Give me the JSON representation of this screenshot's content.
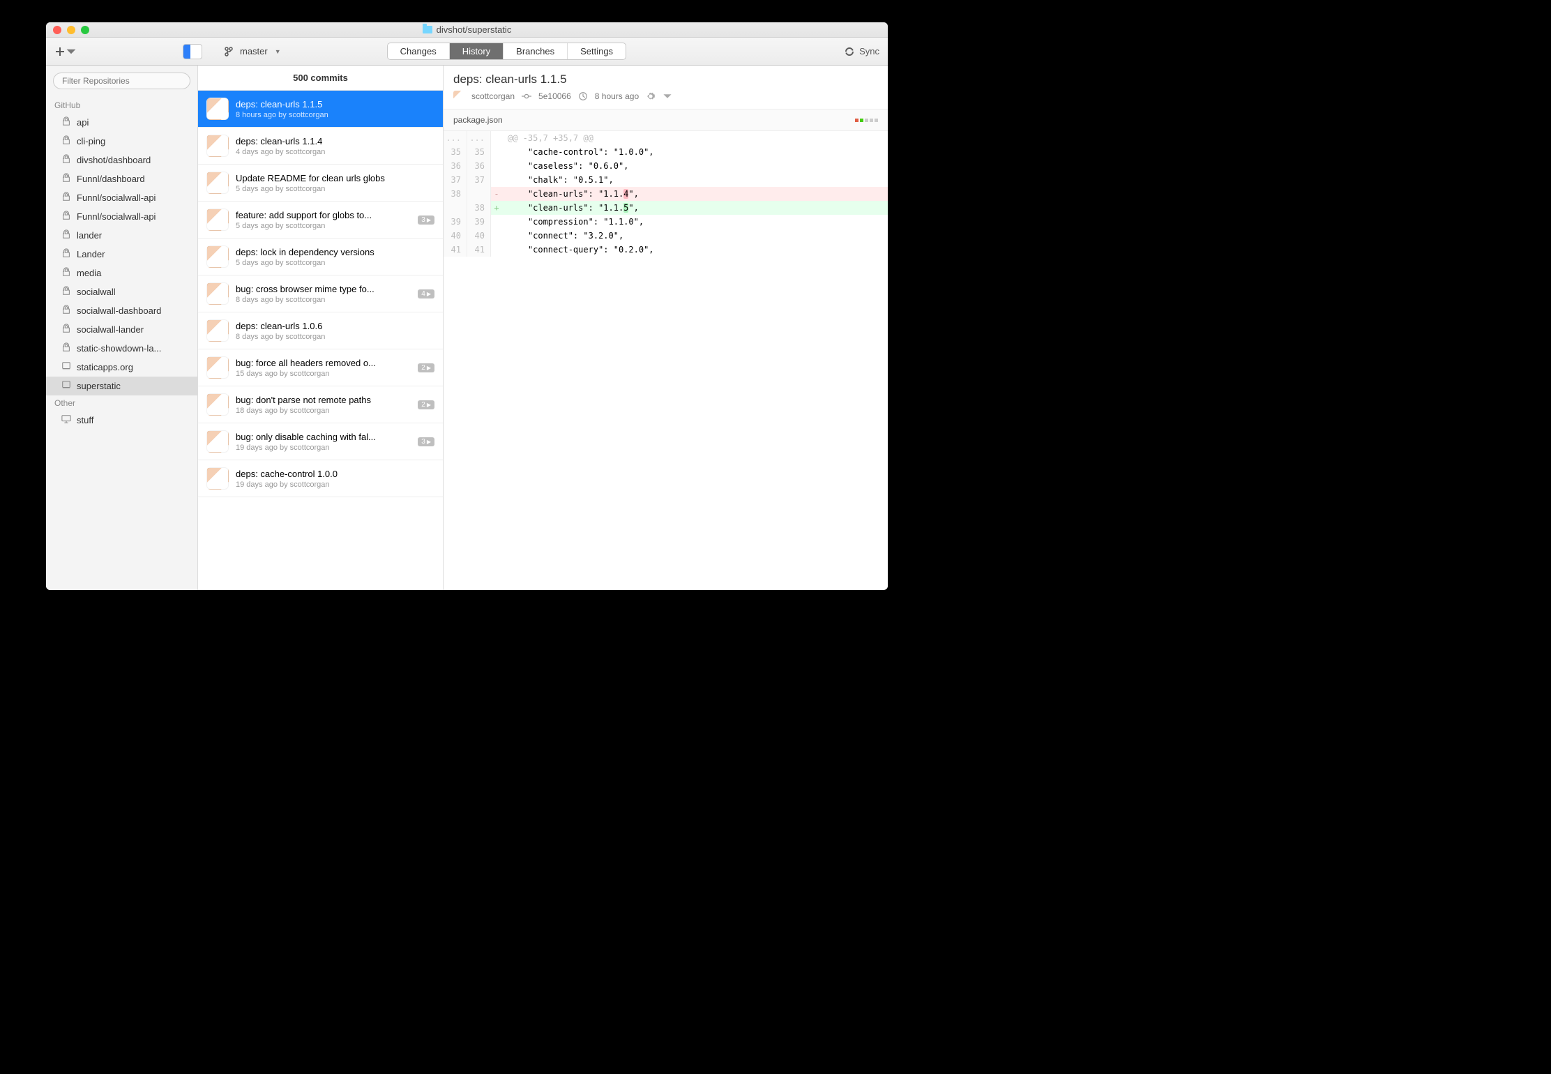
{
  "titlebar": {
    "title": "divshot/superstatic"
  },
  "toolbar": {
    "branch": "master",
    "sync_label": "Sync",
    "tabs": {
      "changes": "Changes",
      "history": "History",
      "branches": "Branches",
      "settings": "Settings",
      "active": "history"
    }
  },
  "sidebar": {
    "filter_placeholder": "Filter Repositories",
    "sections": [
      {
        "label": "GitHub",
        "items": [
          {
            "name": "api",
            "icon": "lock"
          },
          {
            "name": "cli-ping",
            "icon": "lock"
          },
          {
            "name": "divshot/dashboard",
            "icon": "lock"
          },
          {
            "name": "Funnl/dashboard",
            "icon": "lock"
          },
          {
            "name": "Funnl/socialwall-api",
            "icon": "lock"
          },
          {
            "name": "Funnl/socialwall-api",
            "icon": "lock"
          },
          {
            "name": "lander",
            "icon": "lock"
          },
          {
            "name": "Lander",
            "icon": "lock"
          },
          {
            "name": "media",
            "icon": "lock"
          },
          {
            "name": "socialwall",
            "icon": "lock"
          },
          {
            "name": "socialwall-dashboard",
            "icon": "lock"
          },
          {
            "name": "socialwall-lander",
            "icon": "lock"
          },
          {
            "name": "static-showdown-la...",
            "icon": "lock"
          },
          {
            "name": "staticapps.org",
            "icon": "repo"
          },
          {
            "name": "superstatic",
            "icon": "repo",
            "selected": true
          }
        ]
      },
      {
        "label": "Other",
        "items": [
          {
            "name": "stuff",
            "icon": "desktop"
          }
        ]
      }
    ]
  },
  "commits": {
    "header": "500 commits",
    "list": [
      {
        "title": "deps: clean-urls 1.1.5",
        "meta": "8 hours ago by scottcorgan",
        "selected": true
      },
      {
        "title": "deps: clean-urls 1.1.4",
        "meta": "4 days ago by scottcorgan"
      },
      {
        "title": "Update README for clean urls globs",
        "meta": "5 days ago by scottcorgan"
      },
      {
        "title": "feature: add support for globs to...",
        "meta": "5 days ago by scottcorgan",
        "badge": "3"
      },
      {
        "title": "deps: lock in dependency versions",
        "meta": "5 days ago by scottcorgan"
      },
      {
        "title": "bug: cross browser mime type fo...",
        "meta": "8 days ago by scottcorgan",
        "badge": "4"
      },
      {
        "title": "deps: clean-urls 1.0.6",
        "meta": "8 days ago by scottcorgan"
      },
      {
        "title": "bug: force all headers removed o...",
        "meta": "15 days ago by scottcorgan",
        "badge": "2"
      },
      {
        "title": "bug: don't parse not remote paths",
        "meta": "18 days ago by scottcorgan",
        "badge": "2"
      },
      {
        "title": "bug: only disable caching with fal...",
        "meta": "19 days ago by scottcorgan",
        "badge": "3"
      },
      {
        "title": "deps: cache-control 1.0.0",
        "meta": "19 days ago by scottcorgan"
      }
    ]
  },
  "detail": {
    "title": "deps: clean-urls 1.1.5",
    "author": "scottcorgan",
    "sha": "5e10066",
    "time": "8 hours ago",
    "file": "package.json",
    "hunk": "@@ -35,7 +35,7 @@",
    "diff": [
      {
        "old": "35",
        "new": "35",
        "type": "ctx",
        "text": "    \"cache-control\": \"1.0.0\","
      },
      {
        "old": "36",
        "new": "36",
        "type": "ctx",
        "text": "    \"caseless\": \"0.6.0\","
      },
      {
        "old": "37",
        "new": "37",
        "type": "ctx",
        "text": "    \"chalk\": \"0.5.1\","
      },
      {
        "old": "38",
        "new": "",
        "type": "del",
        "pre": "    \"clean-urls\": \"1.1.",
        "hl": "4",
        "post": "\","
      },
      {
        "old": "",
        "new": "38",
        "type": "add",
        "pre": "    \"clean-urls\": \"1.1.",
        "hl": "5",
        "post": "\","
      },
      {
        "old": "39",
        "new": "39",
        "type": "ctx",
        "text": "    \"compression\": \"1.1.0\","
      },
      {
        "old": "40",
        "new": "40",
        "type": "ctx",
        "text": "    \"connect\": \"3.2.0\","
      },
      {
        "old": "41",
        "new": "41",
        "type": "ctx",
        "text": "    \"connect-query\": \"0.2.0\","
      }
    ]
  }
}
